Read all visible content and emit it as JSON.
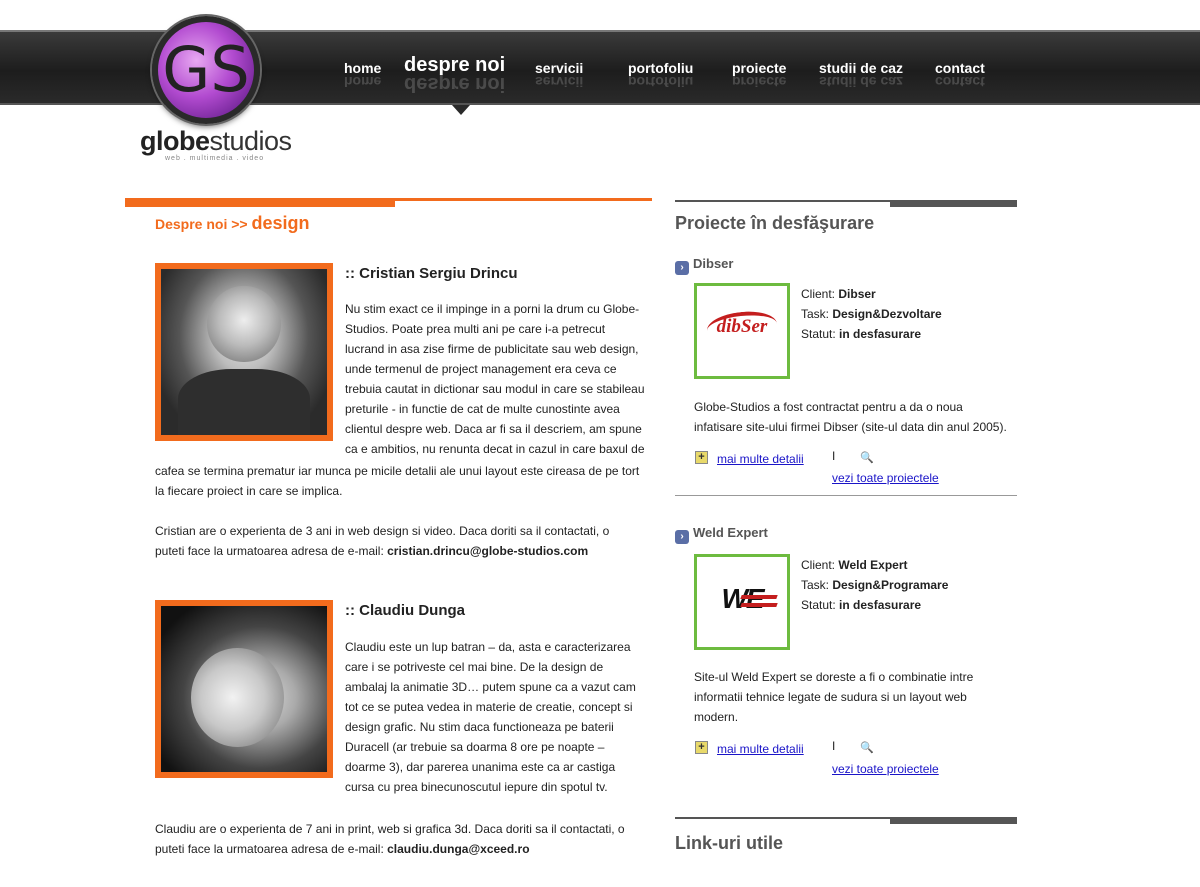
{
  "brand": {
    "logo_text_bold": "globe",
    "logo_text": "studios",
    "tagline": "web . multimedia . video",
    "logo_mark": "GS"
  },
  "nav": [
    {
      "label": "home"
    },
    {
      "label": "despre noi"
    },
    {
      "label": "servicii"
    },
    {
      "label": "portofoliu"
    },
    {
      "label": "proiecte"
    },
    {
      "label": "studii de caz"
    },
    {
      "label": "contact"
    }
  ],
  "breadcrumb": {
    "prefix": "Despre noi >> ",
    "current": "design"
  },
  "people": [
    {
      "name": ":: Cristian Sergiu Drincu",
      "bio_top": [
        "Nu stim exact ce il impinge in a porni la drum cu Globe-",
        "Studios. Poate prea multi ani pe care i-a petrecut",
        "lucrand in asa zise firme de publicitate sau web design,",
        "unde termenul de project management era ceva ce",
        "trebuia cautat in dictionar sau modul in care se stabileau",
        "preturile - in functie de cat de multe cunostinte avea",
        "clientul despre web. Daca ar fi sa il descriem, am spune",
        "ca e ambitios, nu renunta decat in cazul in care baxul de"
      ],
      "bio_bottom": [
        "cafea se termina prematur iar munca pe micile detalii ale unui layout este cireasa de pe tort",
        "la fiecare proiect in care se implica."
      ],
      "contact_line1": "Cristian are o experienta de 3 ani in web design si video. Daca doriti sa il contactati, o",
      "contact_line2": "puteti face la urmatoarea adresa de e-mail: ",
      "email": "cristian.drincu@globe-studios.com"
    },
    {
      "name": ":: Claudiu Dunga",
      "bio_top": [
        "Claudiu este un lup batran – da, asta e caracterizarea",
        "care i se potriveste cel mai bine. De la design de",
        "ambalaj la animatie 3D… putem spune ca a vazut cam",
        "tot ce se putea vedea in materie de creatie, concept si",
        "design grafic. Nu stim daca functioneaza pe baterii",
        "Duracell (ar trebuie sa doarma 8 ore pe noapte –",
        "doarme 3), dar parerea unanima este ca ar castiga",
        "cursa cu prea binecunoscutul iepure din spotul tv."
      ],
      "contact_line1": "Claudiu are o experienta de 7 ani in print, web si grafica 3d. Daca doriti sa il contactati, o",
      "contact_line2": "puteti face la urmatoarea adresa de e-mail: ",
      "email": "claudiu.dunga@xceed.ro"
    }
  ],
  "sidebar": {
    "title": "Proiecte în desfăşurare",
    "links_title": "Link-uri utile",
    "projects": [
      {
        "name": "Dibser",
        "logo_text": "dibSer",
        "client_label": "Client: ",
        "client": "Dibser",
        "task_label": "Task: ",
        "task": "Design&Dezvoltare",
        "status_label": "Statut: ",
        "status": "in desfasurare",
        "desc": [
          "Globe-Studios a fost contractat pentru a da o noua",
          "infatisare site-ului firmei Dibser (site-ul data din anul 2005)."
        ],
        "more_link": "mai multe detalii",
        "pipe": "I",
        "all_link": "vezi toate proiectele"
      },
      {
        "name": "Weld Expert",
        "logo_text": "WE",
        "client_label": "Client: ",
        "client": "Weld Expert",
        "task_label": "Task: ",
        "task": "Design&Programare",
        "status_label": "Statut: ",
        "status": "in desfasurare",
        "desc": [
          "Site-ul Weld Expert se doreste a fi o combinatie intre",
          "informatii tehnice legate de sudura si un layout web",
          "modern."
        ],
        "more_link": "mai multe detalii",
        "pipe": "I",
        "all_link": "vezi toate proiectele"
      }
    ]
  },
  "colors": {
    "accent": "#f26b1d",
    "header_bg": "#1d1d1d",
    "project_border": "#6dbb3f",
    "link": "#1a14c8"
  }
}
